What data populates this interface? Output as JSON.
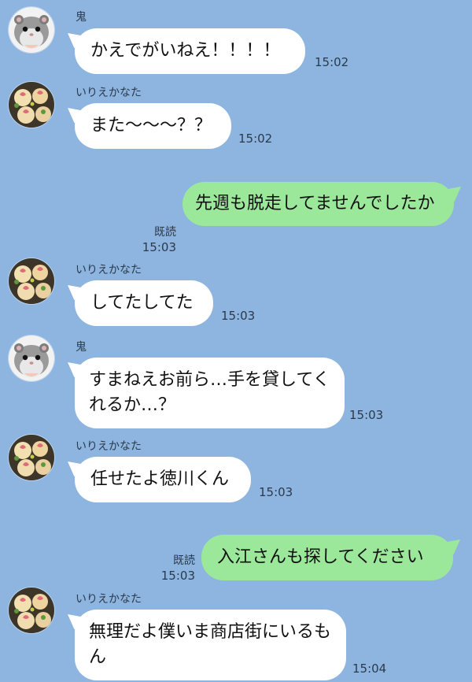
{
  "chat": {
    "users": {
      "oni": "鬼",
      "irie": "いりえかなた"
    },
    "messages": [
      {
        "sender": "鬼",
        "avatar": "hamster-avatar",
        "text": "かえでがいねえ！！！！",
        "time": "15:02"
      },
      {
        "sender": "いりえかなた",
        "avatar": "food-avatar",
        "text": "また〜〜〜？？",
        "time": "15:02"
      },
      {
        "sender": "me",
        "text": "先週も脱走してませんでしたか",
        "read": "既読",
        "time": "15:03"
      },
      {
        "sender": "いりえかなた",
        "avatar": "food-avatar",
        "text": "してたしてた",
        "time": "15:03"
      },
      {
        "sender": "鬼",
        "avatar": "hamster-avatar",
        "text": "すまねえお前ら…手を貸してくれるか…？",
        "time": "15:03"
      },
      {
        "sender": "いりえかなた",
        "avatar": "food-avatar",
        "text": "任せたよ徳川くん",
        "time": "15:03"
      },
      {
        "sender": "me",
        "text": "入江さんも探してください",
        "read": "既読",
        "time": "15:03"
      },
      {
        "sender": "いりえかなた",
        "avatar": "food-avatar",
        "text": "無理だよ僕いま商店街にいるもん",
        "time": "15:04"
      }
    ]
  },
  "colors": {
    "background": "#8db5e0",
    "incoming": "#ffffff",
    "outgoing": "#9be89a"
  }
}
